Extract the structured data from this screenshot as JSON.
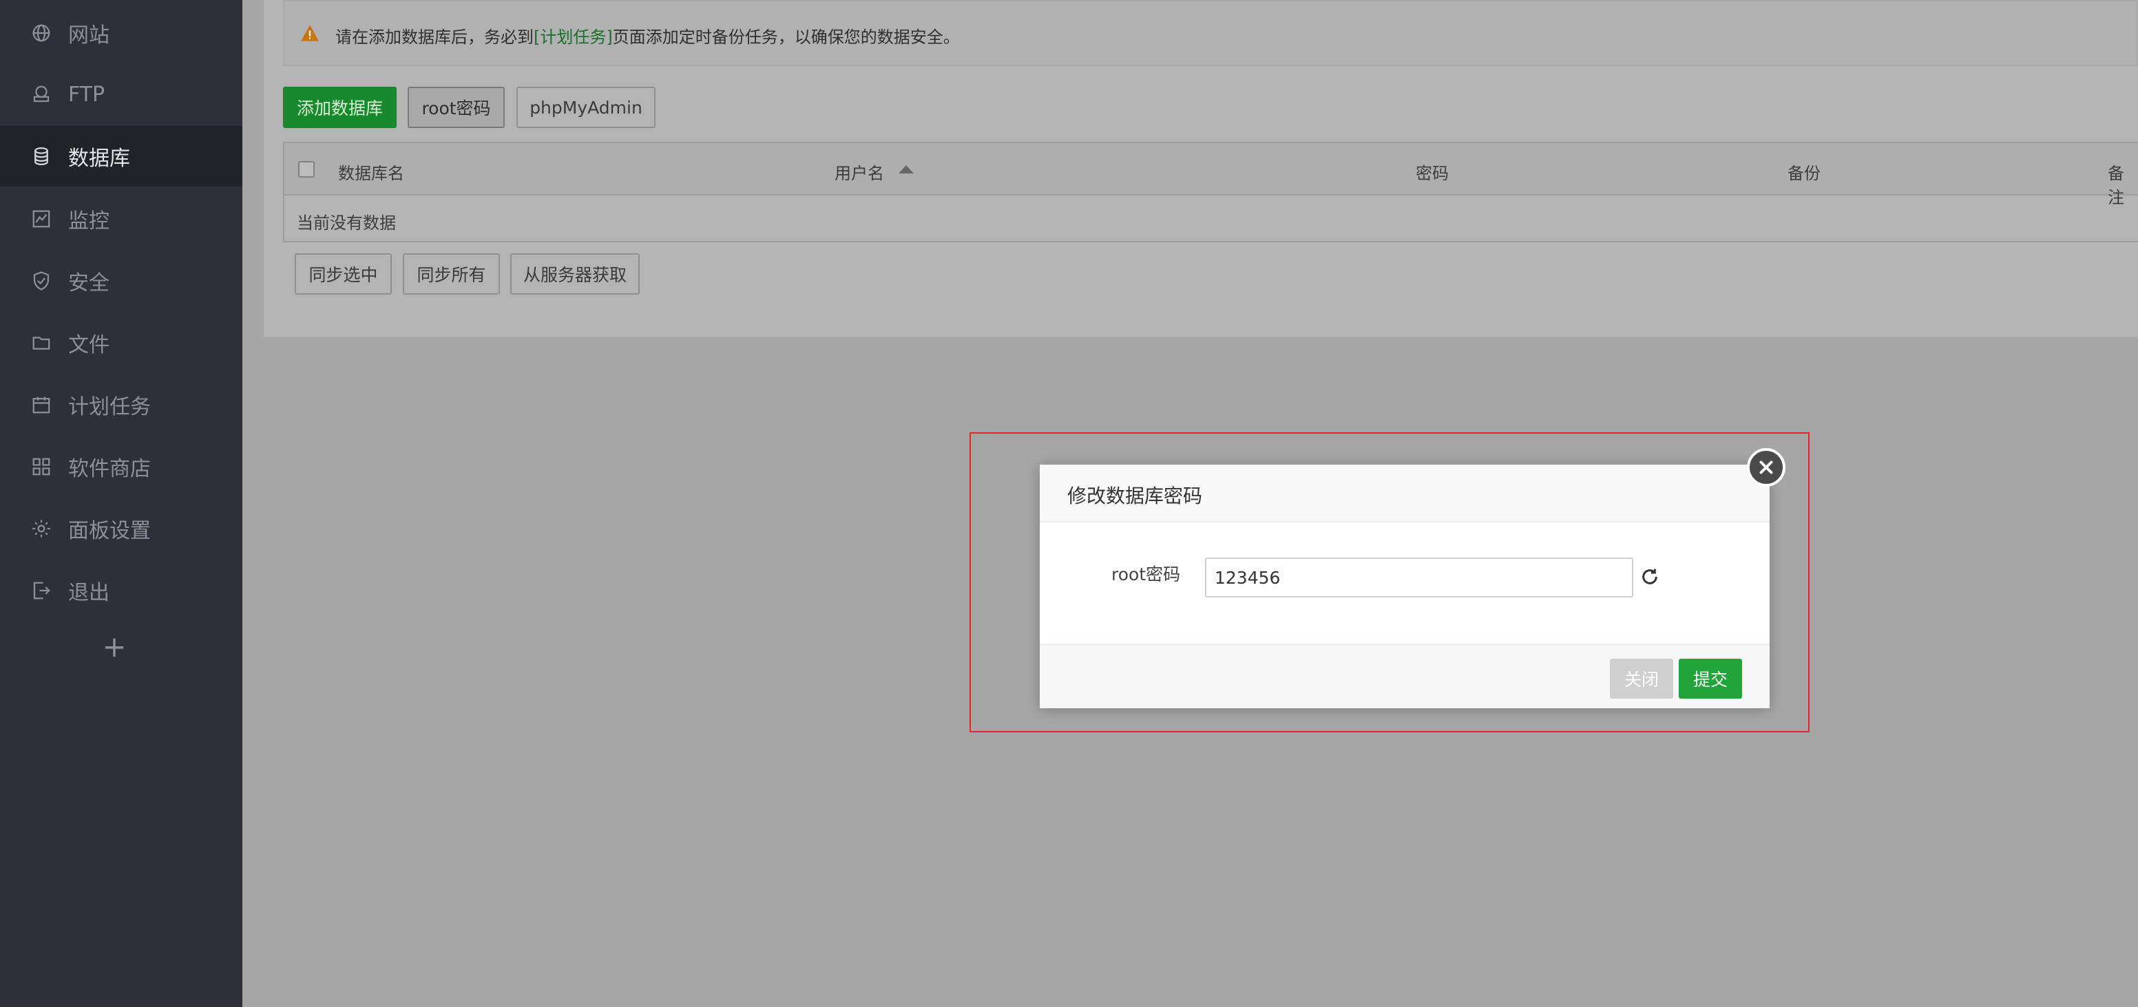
{
  "sidebar": {
    "items": [
      {
        "label": "网站",
        "icon": "globe-icon"
      },
      {
        "label": "FTP",
        "icon": "ftp-icon"
      },
      {
        "label": "数据库",
        "icon": "database-icon"
      },
      {
        "label": "监控",
        "icon": "monitor-icon"
      },
      {
        "label": "安全",
        "icon": "shield-icon"
      },
      {
        "label": "文件",
        "icon": "folder-icon"
      },
      {
        "label": "计划任务",
        "icon": "calendar-icon"
      },
      {
        "label": "软件商店",
        "icon": "grid-icon"
      },
      {
        "label": "面板设置",
        "icon": "gear-icon"
      },
      {
        "label": "退出",
        "icon": "logout-icon"
      }
    ],
    "active_index": 2,
    "add_label": "+"
  },
  "alert": {
    "text_before": "请在添加数据库后，务必到",
    "link": "[计划任务]",
    "text_after": "页面添加定时备份任务，以确保您的数据安全。"
  },
  "toolbar": {
    "add_db": "添加数据库",
    "root_password": "root密码",
    "phpmyadmin": "phpMyAdmin"
  },
  "table": {
    "columns": [
      "数据库名",
      "用户名",
      "密码",
      "备份",
      "备注"
    ],
    "empty_text": "当前没有数据"
  },
  "actions": {
    "sync_selected": "同步选中",
    "sync_all": "同步所有",
    "fetch_from_server": "从服务器获取"
  },
  "modal": {
    "title": "修改数据库密码",
    "field_label": "root密码",
    "field_value": "123456",
    "close_label": "关闭",
    "submit_label": "提交"
  },
  "colors": {
    "sidebar_bg": "#2c3038",
    "accent_green": "#20a53a",
    "highlight_red": "#e8252b"
  }
}
